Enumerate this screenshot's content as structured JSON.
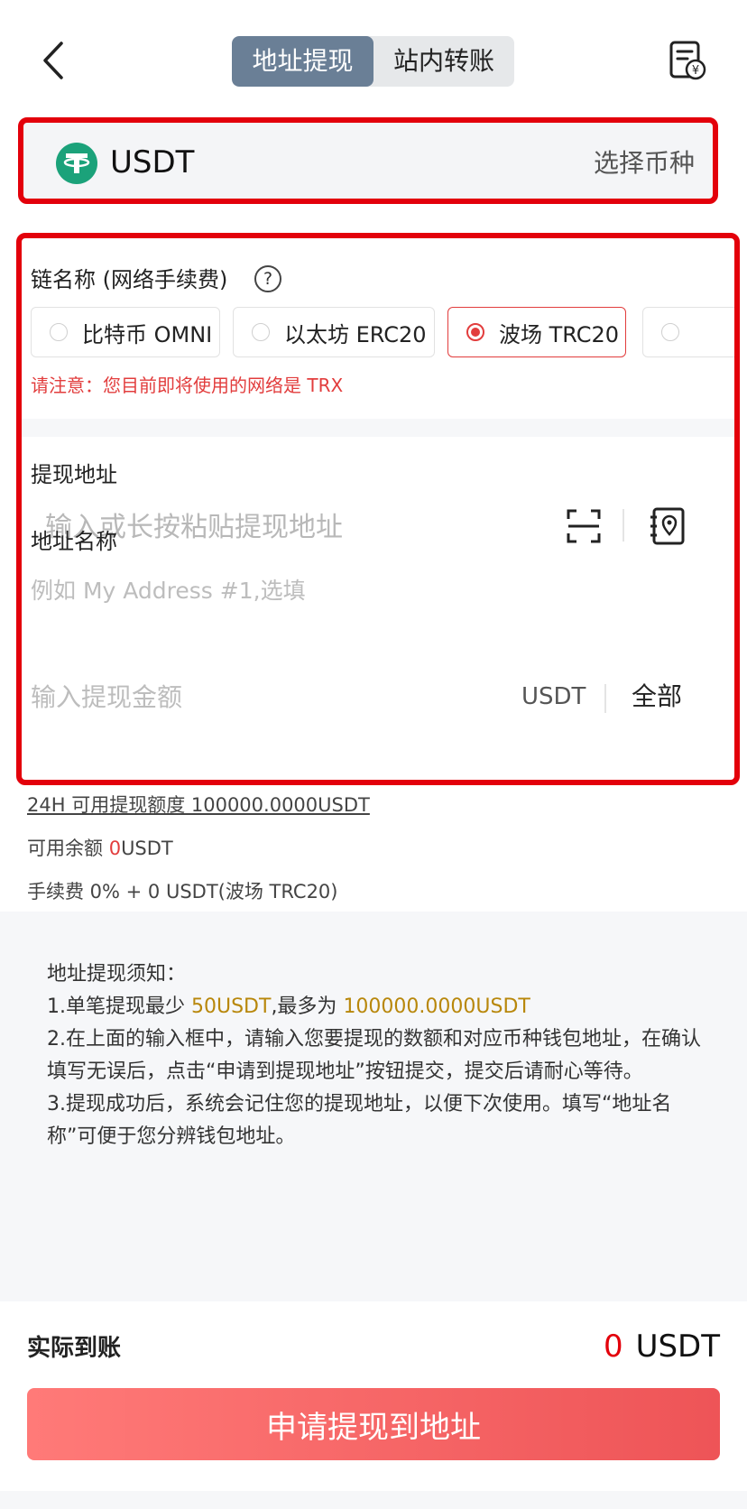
{
  "header": {
    "tabs": [
      {
        "label": "地址提现",
        "active": true
      },
      {
        "label": "站内转账",
        "active": false
      }
    ]
  },
  "coin": {
    "name": "USDT",
    "icon": "tether-icon",
    "select_label": "选择币种"
  },
  "chain": {
    "label": "链名称 (网络手续费)",
    "help": "?",
    "options": [
      {
        "label": "比特币 OMNI",
        "selected": false
      },
      {
        "label": "以太坊 ERC20",
        "selected": false
      },
      {
        "label": "波场 TRC20",
        "selected": true
      }
    ],
    "notice": "请注意：您目前即将使用的网络是 TRX"
  },
  "address": {
    "label": "提现地址",
    "placeholder": "输入或长按粘贴提现地址"
  },
  "address_name": {
    "label": "地址名称",
    "placeholder": "例如 My Address #1,选填"
  },
  "amount": {
    "placeholder": "输入提现金额",
    "unit": "USDT",
    "all_label": "全部"
  },
  "info": {
    "quota": "24H 可用提现额度 100000.0000USDT",
    "balance_label": "可用余额 ",
    "balance_value": "0",
    "balance_unit": "USDT",
    "fee": "手续费 0% + 0 USDT(波场 TRC20)"
  },
  "notes": {
    "title": "地址提现须知：",
    "line1_prefix": "1.单笔提现最少 ",
    "line1_min": "50USDT",
    "line1_mid": ",最多为 ",
    "line1_max": "100000.0000USDT",
    "line2": "2.在上面的输入框中，请输入您要提现的数额和对应币种钱包地址，在确认填写无误后，点击“申请到提现地址”按钮提交，提交后请耐心等待。",
    "line3": "3.提现成功后，系统会记住您的提现地址，以便下次使用。填写“地址名称”可便于您分辨钱包地址。"
  },
  "arrival": {
    "label": "实际到账",
    "value": "0",
    "unit": "USDT"
  },
  "submit_label": "申请提现到地址",
  "colors": {
    "accent_red": "#e3000b",
    "tab_active": "#6a7f96",
    "tether_green": "#1ba27a",
    "highlight_gold": "#b8870b",
    "button_gradient_start": "#ff7a78",
    "button_gradient_end": "#ee5457"
  }
}
